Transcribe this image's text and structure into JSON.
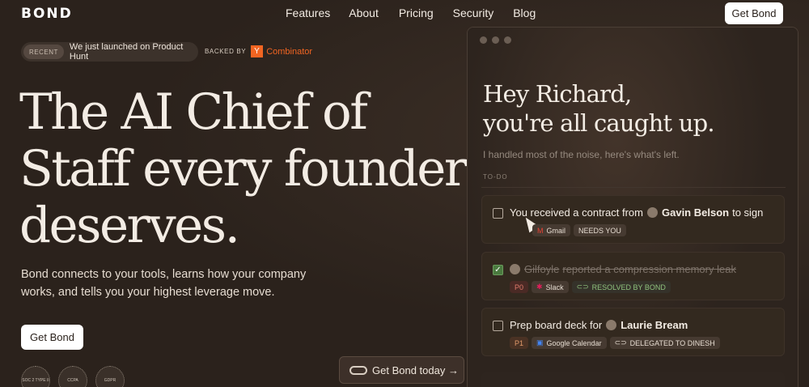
{
  "header": {
    "logo": "BOND",
    "nav": [
      "Features",
      "About",
      "Pricing",
      "Security",
      "Blog"
    ],
    "cta": "Get Bond"
  },
  "announcement": {
    "badge": "RECENT",
    "text": "We just launched on Product Hunt",
    "backed_by": "BACKED BY",
    "yc_logo": "Y",
    "yc_name": "Combinator"
  },
  "hero": {
    "title": "The AI Chief of Staff every founder deserves.",
    "subtitle": "Bond connects to your tools, learns how your company works, and tells you your highest leverage move.",
    "cta": "Get Bond",
    "certs": [
      "SOC 2 TYPE II",
      "CCPA",
      "GDPR"
    ],
    "floating_cta": "Get Bond today →"
  },
  "app": {
    "greeting_line1": "Hey Richard,",
    "greeting_line2": "you're all caught up.",
    "handled": "I handled most of the noise, here's what's left.",
    "todo_label": "TO-DO",
    "tasks": [
      {
        "prefix": "You received a contract from",
        "name": "Gavin Belson",
        "suffix": "to sign",
        "tags": [
          "Gmail",
          "NEEDS YOU"
        ],
        "icons": [
          "gmail-icon"
        ]
      },
      {
        "prefix": "",
        "name": "Gilfoyle",
        "suffix": "reported a compression memory leak",
        "priority": "P0",
        "tags": [
          "Slack",
          "RESOLVED BY BOND"
        ],
        "icons": [
          "slack-icon"
        ]
      },
      {
        "prefix": "Prep board deck for",
        "name": "Laurie Bream",
        "suffix": "",
        "priority": "P1",
        "tags": [
          "Google Calendar",
          "DELEGATED TO DINESH"
        ],
        "icons": [
          "google-calendar-icon"
        ]
      }
    ]
  }
}
